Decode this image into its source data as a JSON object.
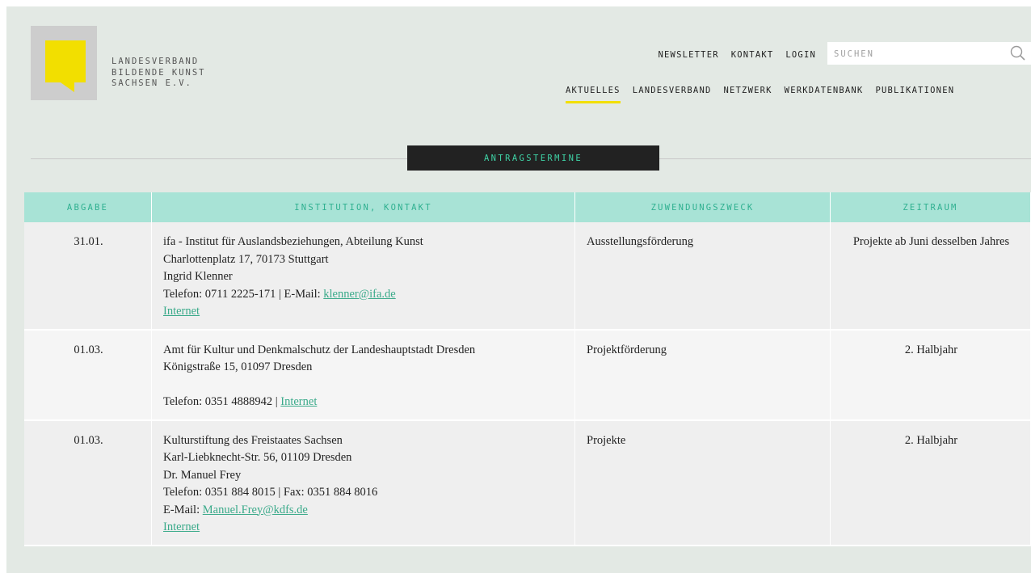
{
  "brand": {
    "name_lines": [
      "LANDESVERBAND",
      "BILDENDE KUNST",
      "SACHSEN E.V."
    ]
  },
  "topnav": [
    "NEWSLETTER",
    "KONTAKT",
    "LOGIN"
  ],
  "search": {
    "placeholder": "SUCHEN"
  },
  "mainnav": [
    "AKTUELLES",
    "LANDESVERBAND",
    "NETZWERK",
    "WERKDATENBANK",
    "PUBLIKATIONEN"
  ],
  "section": {
    "title": "ANTRAGSTERMINE"
  },
  "table": {
    "headers": [
      "ABGABE",
      "INSTITUTION, KONTAKT",
      "ZUWENDUNGSZWECK",
      "ZEITRAUM"
    ],
    "rows": [
      {
        "date": "31.01.",
        "lines": [
          "ifa - Institut für Auslandsbeziehungen, Abteilung Kunst",
          "Charlottenplatz 17, 70173 Stuttgart",
          "Ingrid Klenner"
        ],
        "phone_prefix": "Telefon: 0711 2225-171 | E-Mail: ",
        "email": "klenner@ifa.de",
        "internet": "Internet",
        "purpose": "Ausstellungsförderung",
        "period": "Projekte ab Juni desselben Jahres"
      },
      {
        "date": "01.03.",
        "lines": [
          "Amt für Kultur und Denkmalschutz der Landeshauptstadt Dresden",
          "Königstraße 15, 01097 Dresden"
        ],
        "phone_prefix": "Telefon: 0351 4888942 | ",
        "internet": "Internet",
        "purpose": "Projektförderung",
        "period": "2. Halbjahr"
      },
      {
        "date": "01.03.",
        "lines": [
          "Kulturstiftung des Freistaates Sachsen",
          "Karl-Liebknecht-Str. 56, 01109 Dresden",
          "Dr. Manuel Frey",
          "Telefon: 0351 884 8015 | Fax: 0351 884 8016"
        ],
        "email_prefix": "E-Mail: ",
        "email": "Manuel.Frey@kdfs.de",
        "internet": "Internet",
        "purpose": "Projekte",
        "period": "2. Halbjahr"
      }
    ]
  },
  "colors": {
    "background": "#e3e9e4",
    "accent_yellow": "#f2df00",
    "header_mint": "#a8e3d6",
    "accent_green": "#3fd3a6",
    "link_green": "#3aaa8a"
  }
}
